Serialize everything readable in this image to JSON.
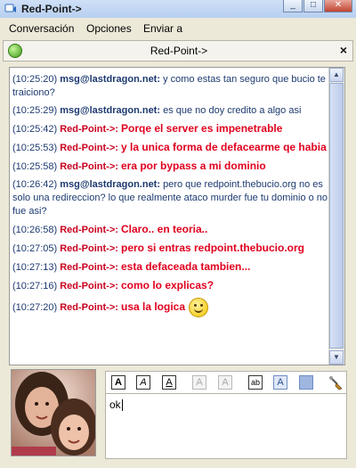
{
  "window": {
    "title": "Red-Point->",
    "minimize_label": "_",
    "maximize_label": "□",
    "close_label": "✕"
  },
  "menu": {
    "items": [
      {
        "label": "Conversación"
      },
      {
        "label": "Opciones"
      },
      {
        "label": "Enviar a"
      }
    ]
  },
  "conversation": {
    "title": "Red-Point->",
    "close_label": "×",
    "status_color": "#3c9a16"
  },
  "messages": [
    {
      "time": "(10:25:20)",
      "sender": "msg@lastdragon.net:",
      "text": "y como estas tan seguro que bucio te traiciono?",
      "type": "other"
    },
    {
      "time": "(10:25:29)",
      "sender": "msg@lastdragon.net:",
      "text": "es que no doy credito a algo asi",
      "type": "other"
    },
    {
      "time": "(10:25:42)",
      "sender": "Red-Point->:",
      "text": "Porqe el server es impenetrable",
      "type": "rp"
    },
    {
      "time": "(10:25:53)",
      "sender": "Red-Point->:",
      "text": "y la unica forma de defacearme qe habia",
      "type": "rp"
    },
    {
      "time": "(10:25:58)",
      "sender": "Red-Point->:",
      "text": "era por bypass a mi dominio",
      "type": "rp"
    },
    {
      "time": "(10:26:42)",
      "sender": "msg@lastdragon.net:",
      "text": "pero que redpoint.thebucio.org no es solo una redireccion? lo que realmente ataco murder fue tu dominio o no fue asi?",
      "type": "other"
    },
    {
      "time": "(10:26:58)",
      "sender": "Red-Point->:",
      "text": "Claro.. en teoria..",
      "type": "rp"
    },
    {
      "time": "(10:27:05)",
      "sender": "Red-Point->:",
      "text": "pero si entras redpoint.thebucio.org",
      "type": "rp"
    },
    {
      "time": "(10:27:13)",
      "sender": "Red-Point->:",
      "text": "esta defaceada tambien...",
      "type": "rp"
    },
    {
      "time": "(10:27:16)",
      "sender": "Red-Point->:",
      "text": "como lo explicas?",
      "type": "rp"
    },
    {
      "time": "(10:27:20)",
      "sender": "Red-Point->:",
      "text": "usa la logica",
      "type": "rp",
      "emoticon": "smiley-icon"
    }
  ],
  "toolbar": {
    "bold_label": "A",
    "italic_label": "A",
    "underline_label": "A",
    "font_up_label": "A",
    "font_down_label": "A",
    "abbrev_label": "ab",
    "color_label": "A",
    "bg_label": "",
    "brush_label": ""
  },
  "input": {
    "value": "ok"
  },
  "colors": {
    "other_sender": "#1d3a70",
    "rp_sender": "#c8001e",
    "rp_text": "#e0001e"
  }
}
